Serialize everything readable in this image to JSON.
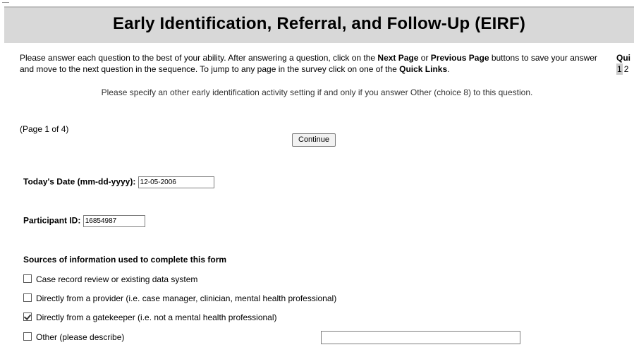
{
  "header": {
    "title": "Early Identification, Referral, and Follow-Up (EIRF)"
  },
  "intro": {
    "p1": "Please answer each question to the best of your ability. After answering a question, click on the ",
    "next": "Next Page",
    "p2": " or ",
    "prev": "Previous Page",
    "p3": " buttons to save your answer and move to the next question in the sequence. To jump to any page in the survey click on one of the ",
    "quick": "Quick Links",
    "p4": "."
  },
  "quick_links": {
    "title": "Qui",
    "pages": [
      "1",
      "2"
    ]
  },
  "note": "Please specify an other early identification activity setting if and only if you answer Other (choice 8) to this question.",
  "page_info": "(Page 1 of 4)",
  "continue_label": "Continue",
  "date_field": {
    "label": "Today's Date (mm-dd-yyyy):",
    "value": "12-05-2006"
  },
  "participant_field": {
    "label": "Participant ID:",
    "value": "16854987"
  },
  "sources": {
    "title": "Sources of information used to complete this form",
    "options": [
      {
        "label": "Case record review or existing data system",
        "checked": false
      },
      {
        "label": "Directly from a provider (i.e. case manager, clinician, mental health professional)",
        "checked": false
      },
      {
        "label": "Directly from a gatekeeper (i.e. not a mental health professional)",
        "checked": true
      },
      {
        "label": "Other (please describe)",
        "checked": false
      }
    ],
    "other_value": ""
  }
}
